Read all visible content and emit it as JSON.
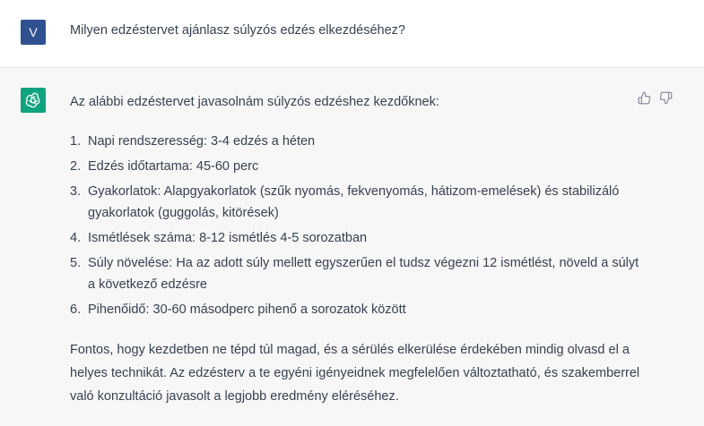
{
  "user": {
    "avatar_letter": "V",
    "message": "Milyen edzéstervet ajánlasz súlyzós edzés elkezdéséhez?"
  },
  "assistant": {
    "avatar_icon": "openai-logo-icon",
    "intro": "Az alábbi edzéstervet javasolnám súlyzós edzéshez kezdőknek:",
    "items": [
      {
        "num": "1.",
        "text": "Napi rendszeresség: 3-4 edzés a héten"
      },
      {
        "num": "2.",
        "text": "Edzés időtartama: 45-60 perc"
      },
      {
        "num": "3.",
        "text": "Gyakorlatok: Alapgyakorlatok (szűk nyomás, fekvenyomás, hátizom-emelések) és stabilizáló gyakorlatok (guggolás, kitörések)"
      },
      {
        "num": "4.",
        "text": "Ismétlések száma: 8-12 ismétlés 4-5 sorozatban"
      },
      {
        "num": "5.",
        "text": "Súly növelése: Ha az adott súly mellett egyszerűen el tudsz végezni 12 ismétlést, növeld a súlyt a következő edzésre"
      },
      {
        "num": "6.",
        "text": "Pihenőidő: 30-60 másodperc pihenő a sorozatok között"
      }
    ],
    "outro": "Fontos, hogy kezdetben ne tépd túl magad, és a sérülés elkerülése érdekében mindig olvasd el a helyes technikát. Az edzésterv a te egyéni igényeidnek megfelelően változtatható, és szakemberrel való konzultáció javasolt a legjobb eredmény eléréséhez."
  },
  "feedback": {
    "like_icon": "thumbs-up-icon",
    "dislike_icon": "thumbs-down-icon"
  },
  "colors": {
    "user_avatar_bg": "#2f5191",
    "bot_avatar_bg": "#10a37f",
    "assistant_bg": "#f7f7f8",
    "text": "#374151"
  }
}
